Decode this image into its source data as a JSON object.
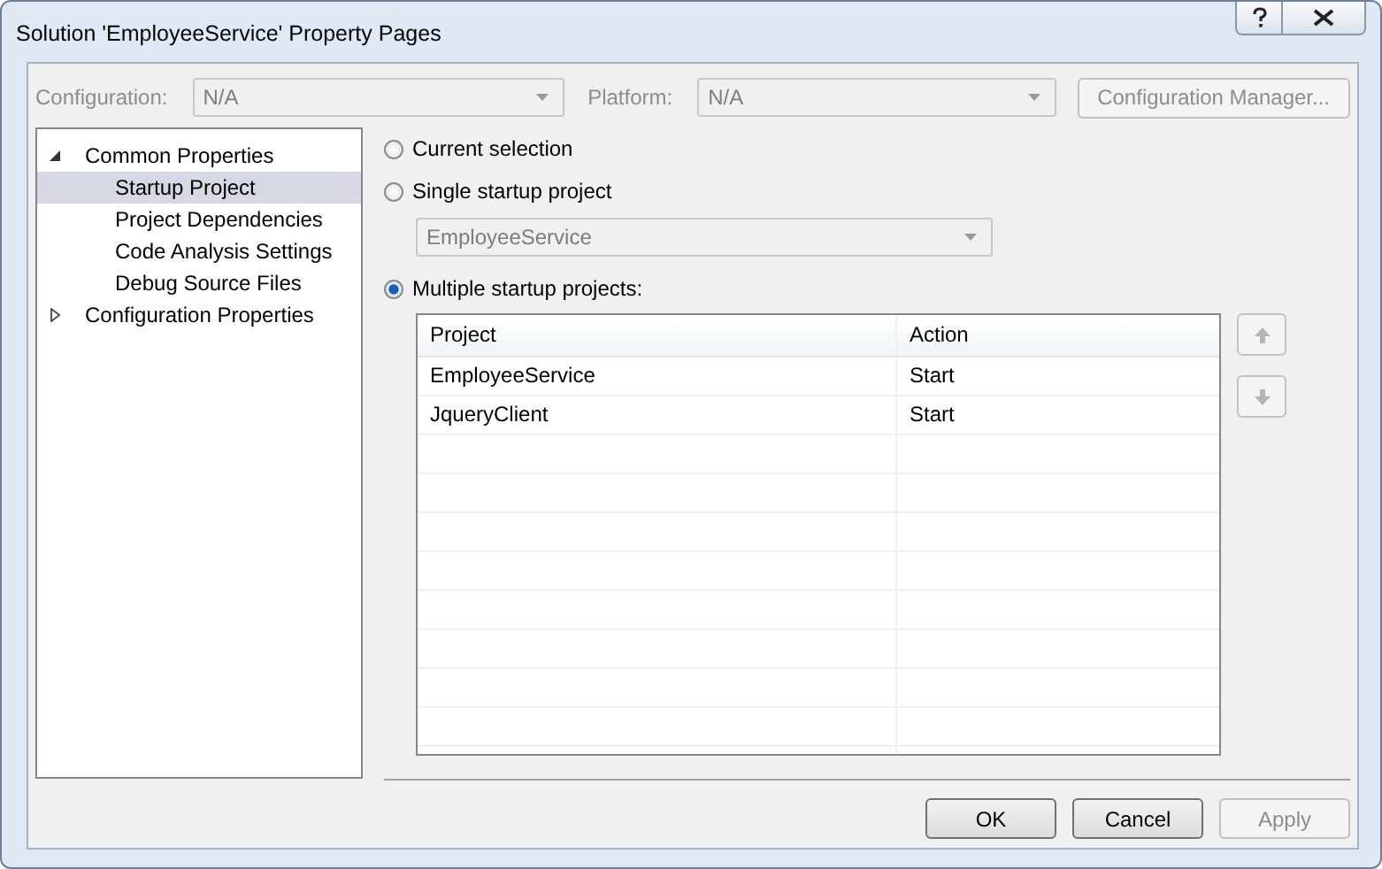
{
  "window": {
    "title": "Solution 'EmployeeService' Property Pages"
  },
  "config_bar": {
    "configuration": {
      "label": "Configuration:",
      "value": "N/A",
      "disabled": true
    },
    "platform": {
      "label": "Platform:",
      "value": "N/A",
      "disabled": true
    },
    "manager_button": {
      "label": "Configuration Manager...",
      "disabled": true
    }
  },
  "tree": [
    {
      "label": "Common Properties",
      "expanded": true,
      "selected": false,
      "children": [
        {
          "label": "Startup Project",
          "selected": true
        },
        {
          "label": "Project Dependencies",
          "selected": false
        },
        {
          "label": "Code Analysis Settings",
          "selected": false
        },
        {
          "label": "Debug Source Files",
          "selected": false
        }
      ]
    },
    {
      "label": "Configuration Properties",
      "expanded": false,
      "selected": false
    }
  ],
  "startup_options": [
    {
      "kind": "plain",
      "label": "Current selection",
      "selected": false
    },
    {
      "kind": "combo",
      "label": "Single startup project",
      "selected": false,
      "combo": {
        "value": "EmployeeService",
        "disabled": true
      }
    },
    {
      "kind": "table",
      "label": "Multiple startup projects:",
      "selected": true
    }
  ],
  "table": {
    "columns": [
      "Project",
      "Action"
    ],
    "rows": [
      {
        "project": "EmployeeService",
        "action": "Start"
      },
      {
        "project": "JqueryClient",
        "action": "Start"
      }
    ]
  },
  "move_buttons": [
    {
      "kind": "up",
      "disabled": true
    },
    {
      "kind": "down",
      "disabled": true
    }
  ],
  "buttons": [
    {
      "label": "OK",
      "disabled": false
    },
    {
      "label": "Cancel",
      "disabled": false
    },
    {
      "label": "Apply",
      "disabled": true
    }
  ]
}
